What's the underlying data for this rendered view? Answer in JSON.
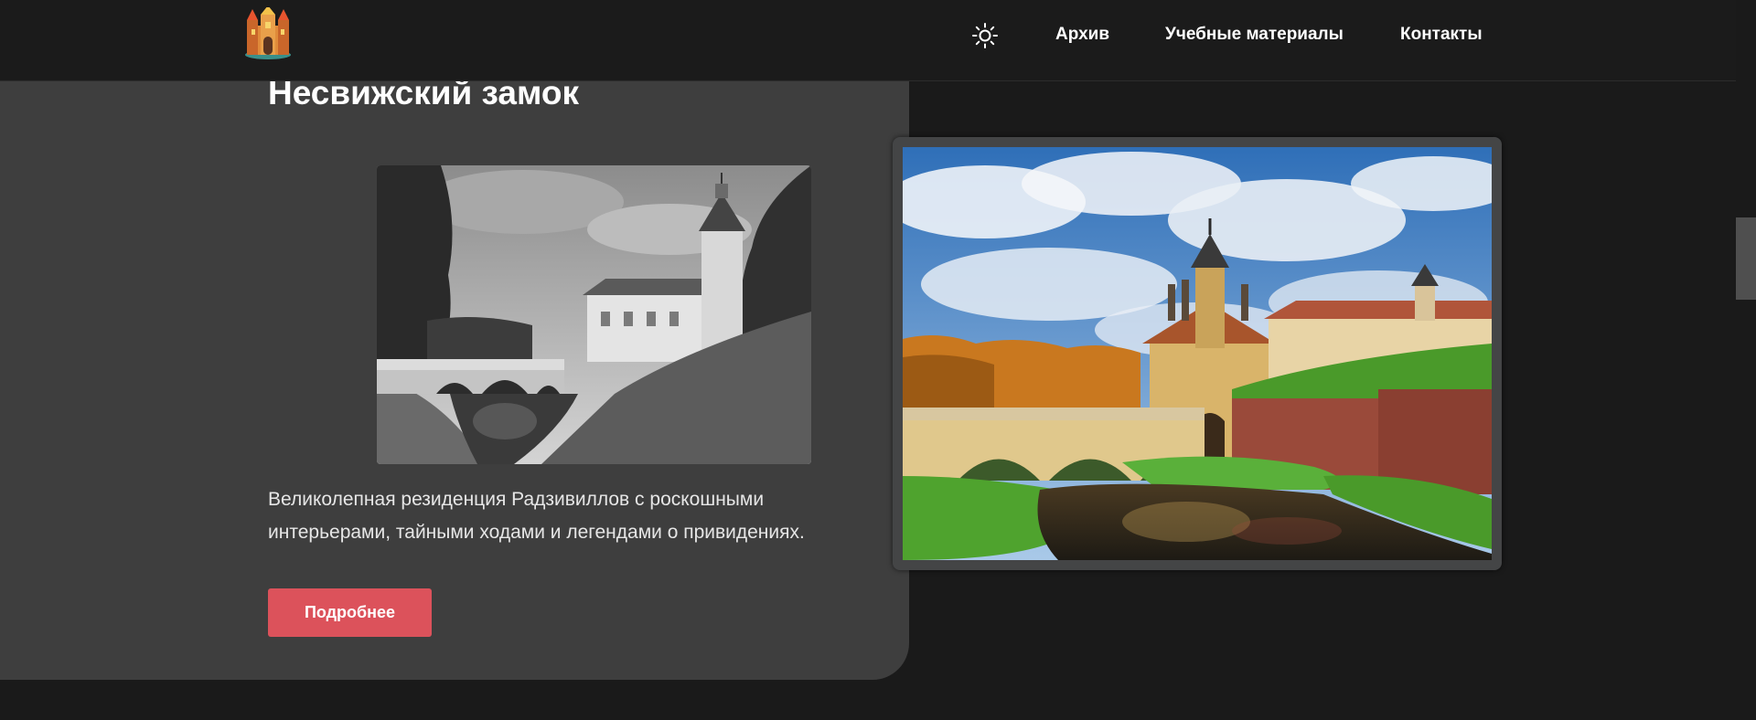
{
  "header": {
    "logo_icon": "castle-logo-icon",
    "theme_toggle_icon": "sun-icon",
    "nav": {
      "archive": "Архив",
      "materials": "Учебные материалы",
      "contacts": "Контакты"
    }
  },
  "card": {
    "title": "Несвижский замок",
    "description": "Великолепная резиденция Радзивиллов с роскошными интерьерами, тайными ходами и легендами о привидениях.",
    "button_label": "Подробнее"
  },
  "images": {
    "old_photo_icon": "black-and-white-castle-photo",
    "main_photo_icon": "color-castle-photo"
  },
  "colors": {
    "page_bg": "#1a1a1a",
    "card_bg": "#3e3e3e",
    "accent_button": "#dc525b",
    "frame": "#444546",
    "scrollbar_thumb": "#4f4f4f"
  }
}
